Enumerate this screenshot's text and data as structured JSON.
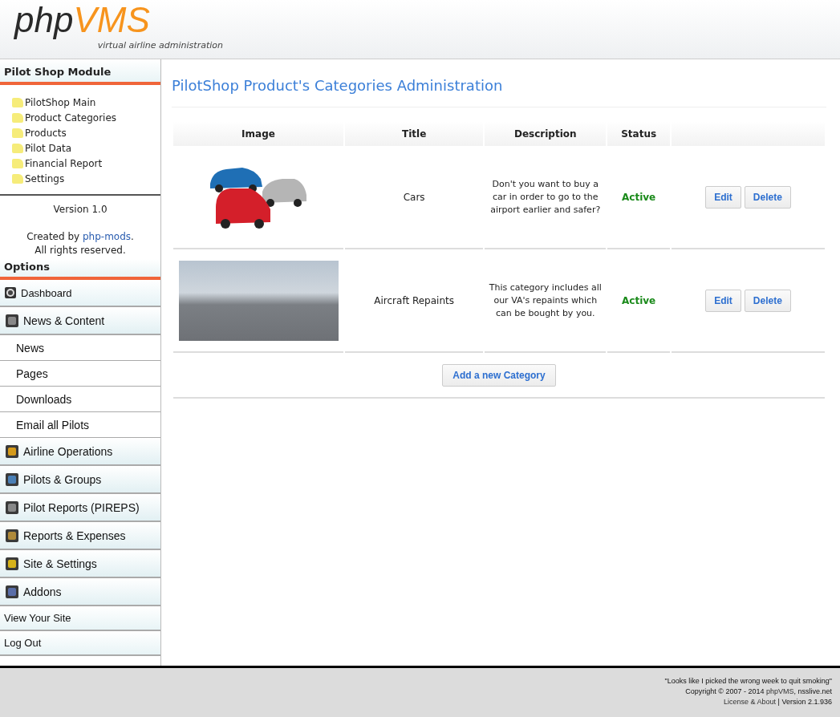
{
  "header": {
    "logo_left": "php",
    "logo_right": "VMS",
    "tagline": "virtual airline administration"
  },
  "module": {
    "title": "Pilot Shop Module",
    "items": [
      "PilotShop Main",
      "Product Categories",
      "Products",
      "Pilot Data",
      "Financial Report",
      "Settings"
    ],
    "version": "Version 1.0",
    "credit_before": "Created by ",
    "credit_link": "php-mods",
    "credit_after": ".",
    "rights": "All rights reserved."
  },
  "options": {
    "title": "Options",
    "items": [
      {
        "kind": "top",
        "label": "Dashboard"
      },
      {
        "kind": "section",
        "label": "News & Content"
      },
      {
        "kind": "sub",
        "label": "News"
      },
      {
        "kind": "sub",
        "label": "Pages"
      },
      {
        "kind": "sub",
        "label": "Downloads"
      },
      {
        "kind": "sub",
        "label": "Email all Pilots"
      },
      {
        "kind": "section",
        "label": "Airline Operations"
      },
      {
        "kind": "section",
        "label": "Pilots & Groups"
      },
      {
        "kind": "section",
        "label": "Pilot Reports (PIREPS)"
      },
      {
        "kind": "section",
        "label": "Reports & Expenses"
      },
      {
        "kind": "section",
        "label": "Site & Settings"
      },
      {
        "kind": "section",
        "label": "Addons"
      },
      {
        "kind": "plain",
        "label": "View Your Site"
      },
      {
        "kind": "plain",
        "label": "Log Out"
      }
    ]
  },
  "page_title": "PilotShop Product's Categories Administration",
  "table": {
    "columns": [
      "Image",
      "Title",
      "Description",
      "Status"
    ],
    "rows": [
      {
        "kind": "cars",
        "title": "Cars",
        "description": "Don't you want to buy a car in order to go to the airport earlier and safer?",
        "status": "Active",
        "active": true,
        "actions": [
          "Edit",
          "Delete"
        ]
      },
      {
        "kind": "aircraft",
        "title": "Aircraft Repaints",
        "description": "This category includes all our VA's repaints which can be bought by you.",
        "status": "Active",
        "active": true,
        "actions": [
          "Edit",
          "Delete"
        ]
      }
    ],
    "add_button": "Add a new Category"
  },
  "footer": {
    "quote": "\"Looks like I picked the wrong week to quit smoking\"",
    "copyright_before": "Copyright © 2007 - 2014 ",
    "copyright_link": "phpVMS",
    "copyright_after": ", nsslive.net",
    "license_link": "License & About",
    "version": " | Version 2.1.936"
  }
}
